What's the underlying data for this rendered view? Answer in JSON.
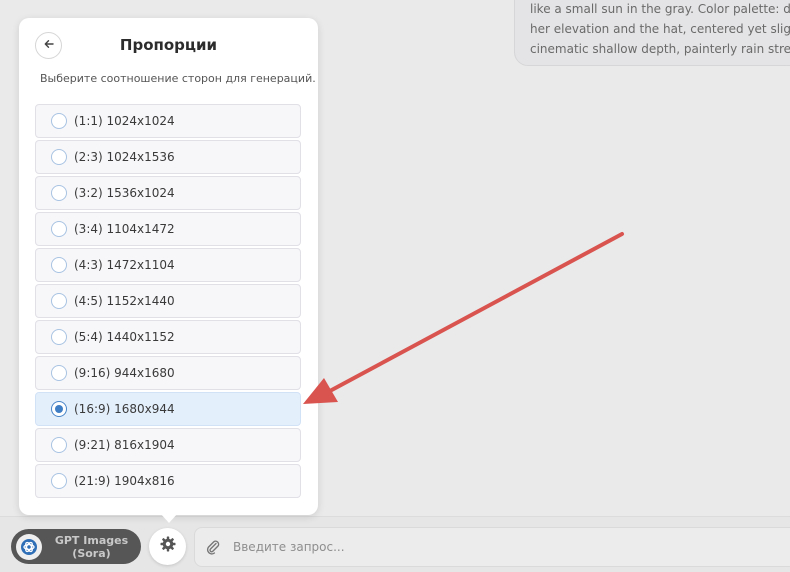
{
  "background_message": {
    "lines": [
      "like a small sun in the gray. Color palette: desat",
      "her elevation and the hat, centered yet slightly",
      "cinematic shallow depth, painterly rain streaks,"
    ]
  },
  "popup": {
    "title": "Пропорции",
    "subtitle": "Выберите соотношение сторон для генераций.",
    "selected_index": 8,
    "options": [
      "(1:1) 1024x1024",
      "(2:3) 1024x1536",
      "(3:2) 1536x1024",
      "(3:4) 1104x1472",
      "(4:3) 1472x1104",
      "(4:5) 1152x1440",
      "(5:4) 1440x1152",
      "(9:16) 944x1680",
      "(16:9) 1680x944",
      "(9:21) 816x1904",
      "(21:9) 1904x816"
    ]
  },
  "bottom_bar": {
    "model_line1": "GPT Images",
    "model_line2": "(Sora)",
    "prompt_placeholder": "Введите запрос..."
  },
  "colors": {
    "accent": "#3f7ec4",
    "arrow": "#d9534f",
    "selected_bg": "#e4effc"
  },
  "icons": {
    "back": "arrow-left-icon",
    "settings": "gear-icon",
    "attach": "paperclip-icon",
    "model": "openai-logo-icon"
  }
}
